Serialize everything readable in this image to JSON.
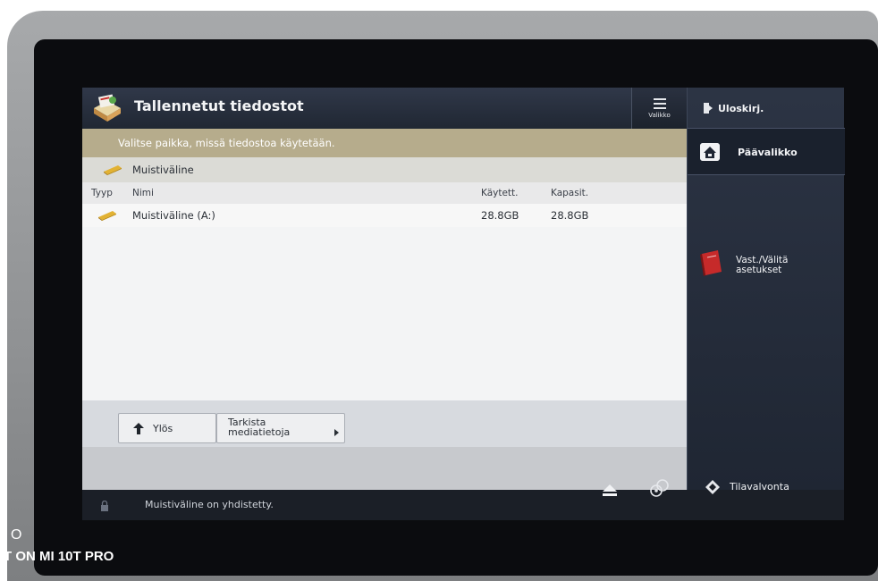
{
  "header": {
    "title": "Tallennetut tiedostot",
    "menu_label": "Valikko"
  },
  "instruction": "Valitse paikka, missä tiedostoa käytetään.",
  "location": {
    "label": "Muistiväline"
  },
  "table": {
    "columns": {
      "type": "Tyyp",
      "name": "Nimi",
      "used": "Käytett.",
      "capacity": "Kapasit."
    },
    "rows": [
      {
        "name": "Muistiväline (A:)",
        "used": "28.8GB",
        "capacity": "28.8GB"
      }
    ]
  },
  "buttons": {
    "up": "Ylös",
    "check_media": "Tarkista\nmediatietoja"
  },
  "sidebar": {
    "logout": "Uloskirj.",
    "home": "Päävalikko",
    "favorites": "Vast./Välitä\nasetukset",
    "status_monitor": "Tilavalvonta"
  },
  "status": {
    "message": "Muistiväline on yhdistetty."
  },
  "watermark": {
    "line1": "O",
    "line2": "T ON MI 10T PRO"
  },
  "colors": {
    "instruction_bg": "#b6ac8c",
    "title_bg": "#252c3a",
    "favorite_book": "#c62a2a"
  },
  "icons": [
    "app-folder-icon",
    "menu-icon",
    "logout-icon",
    "home-icon",
    "book-icon",
    "usb-drive-icon",
    "up-arrow-icon",
    "eject-icon",
    "settings-icon",
    "status-monitor-icon",
    "lock-icon"
  ]
}
